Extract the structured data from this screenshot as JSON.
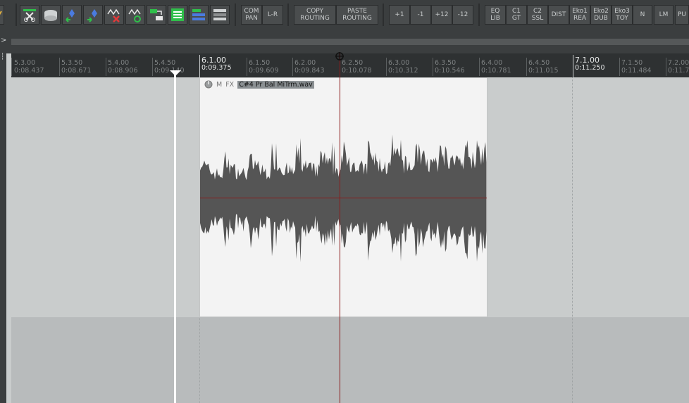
{
  "toolbar": {
    "buttons": [
      {
        "label": "COM\nPAN"
      },
      {
        "label": "L-R"
      },
      {
        "label": "COPY\nROUTING"
      },
      {
        "label": "PASTE\nROUTING"
      },
      {
        "label": "+1"
      },
      {
        "label": "-1"
      },
      {
        "label": "+12"
      },
      {
        "label": "-12"
      },
      {
        "label": "EQ\nLIB"
      },
      {
        "label": "C1\nGT"
      },
      {
        "label": "C2\nSSL"
      },
      {
        "label": "DIST"
      },
      {
        "label": "Eko1\nREA"
      },
      {
        "label": "Eko2\nDUB"
      },
      {
        "label": "Eko3\nTOY"
      },
      {
        "label": "N"
      },
      {
        "label": "LM"
      },
      {
        "label": "PU"
      }
    ]
  },
  "ruler": {
    "ticks": [
      {
        "bar": "5.3.00",
        "time": "0:08.437"
      },
      {
        "bar": "5.3.50",
        "time": "0:08.671"
      },
      {
        "bar": "5.4.00",
        "time": "0:08.906"
      },
      {
        "bar": "5.4.50",
        "time": "0:09.140"
      },
      {
        "bar": "6.1.00",
        "time": "0:09.375"
      },
      {
        "bar": "6.1.50",
        "time": "0:09.609"
      },
      {
        "bar": "6.2.00",
        "time": "0:09.843"
      },
      {
        "bar": "6.2.50",
        "time": "0:10.078"
      },
      {
        "bar": "6.3.00",
        "time": "0:10.312"
      },
      {
        "bar": "6.3.50",
        "time": "0:10.546"
      },
      {
        "bar": "6.4.00",
        "time": "0:10.781"
      },
      {
        "bar": "6.4.50",
        "time": "0:11.015"
      },
      {
        "bar": "7.1.00",
        "time": "0:11.250"
      },
      {
        "bar": "7.1.50",
        "time": "0:11.484"
      },
      {
        "bar": "7.2.00",
        "time": "0:11.7"
      }
    ]
  },
  "item": {
    "mute_label": "M",
    "fx_label": "FX",
    "name": "C#4 Pr Bal MiTrm.wav"
  },
  "left": {
    "arrow": ">"
  },
  "colors": {
    "toolbar_bg": "#3b3e3f",
    "ruler_bg": "#2e3132",
    "arrange_bg": "#c9cccc",
    "item_bg": "#f3f3f3",
    "waveform": "#555555",
    "playhead": "#8a1a1a",
    "edit_cursor": "#ffffff"
  }
}
